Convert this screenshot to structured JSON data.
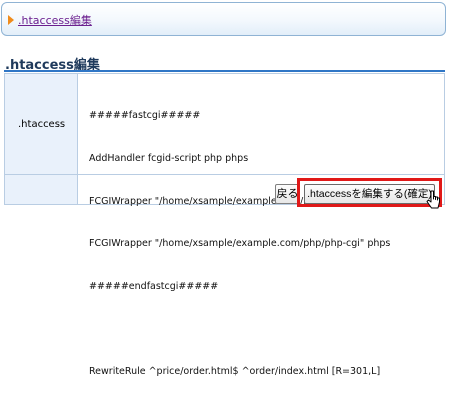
{
  "nav": {
    "link_label": ".htaccess編集"
  },
  "section": {
    "title": ".htaccess編集"
  },
  "form": {
    "field_label": ".htaccess",
    "code_lines": [
      "#####fastcgi#####",
      "AddHandler fcgid-script php phps",
      "FCGIWrapper \"/home/xsample/example.com/php/php-cgi\" php",
      "FCGIWrapper \"/home/xsample/example.com/php/php-cgi\" phps",
      "#####endfastcgi#####",
      "",
      "RewriteRule ^price/order.html$ ^order/index.html [R=301,L]"
    ]
  },
  "buttons": {
    "back_label": "戻る",
    "submit_label": ".htaccessを編集する(確定)"
  },
  "colors": {
    "accent_blue": "#2f76c6",
    "link_purple": "#6b1f8f",
    "arrow_orange": "#f08c1c",
    "highlight_red": "#e01818",
    "label_bg": "#e9f1fb"
  },
  "icons": {
    "nav_arrow": "arrow-right-icon",
    "cursor": "mouse-pointer-icon"
  }
}
